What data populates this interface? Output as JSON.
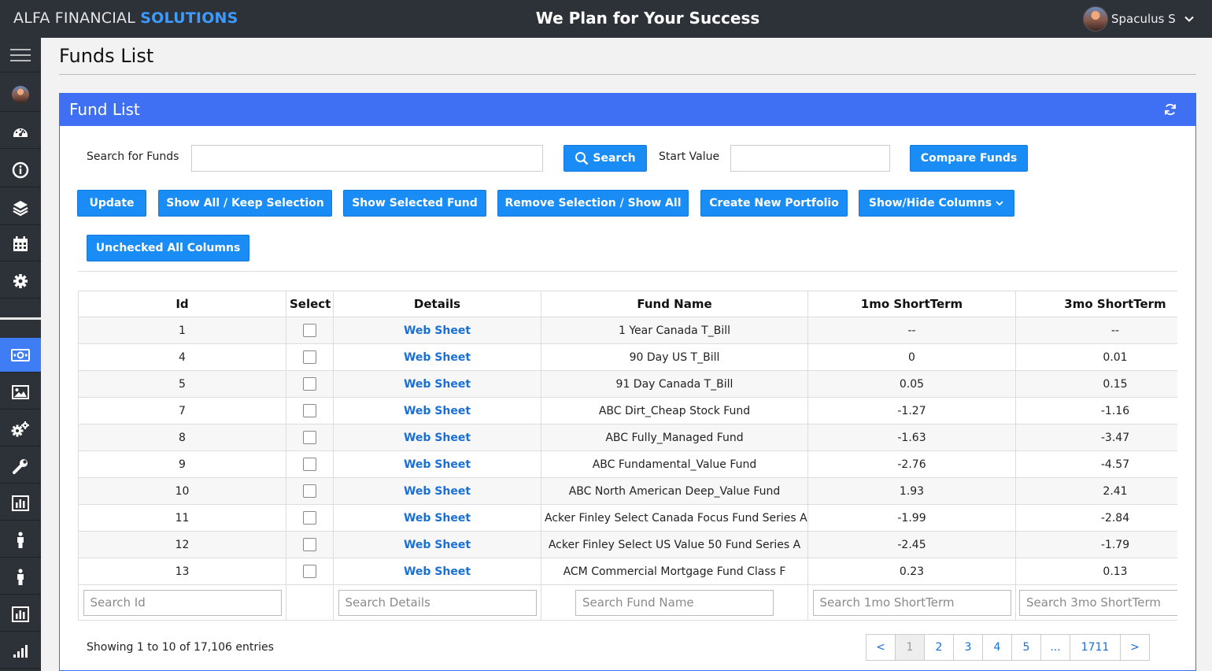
{
  "app": {
    "brand_part1": "ALFA FINANCIAL ",
    "brand_part2": "SOLUTIONS",
    "tagline": "We Plan for Your Success",
    "user_name": "Spaculus S"
  },
  "sidebar": {
    "items": [
      {
        "icon": "hamburger-menu-icon"
      },
      {
        "icon": "user-avatar-icon"
      },
      {
        "icon": "dashboard-icon"
      },
      {
        "icon": "info-icon"
      },
      {
        "icon": "layers-icon"
      },
      {
        "icon": "calendar-icon"
      },
      {
        "icon": "gear-icon"
      },
      {
        "icon": "money-icon",
        "active": true
      },
      {
        "icon": "image-icon"
      },
      {
        "icon": "cogs-icon"
      },
      {
        "icon": "wrench-icon"
      },
      {
        "icon": "bar-chart-icon"
      },
      {
        "icon": "person-icon"
      },
      {
        "icon": "person-icon"
      },
      {
        "icon": "bar-chart-icon"
      },
      {
        "icon": "signal-icon"
      }
    ]
  },
  "page": {
    "title": "Funds List"
  },
  "panel": {
    "title": "Fund List",
    "search_label": "Search for Funds",
    "search_value": "",
    "search_button": "Search",
    "start_value_label": "Start Value",
    "start_value": "",
    "compare_button": "Compare Funds",
    "buttons": {
      "update": "Update",
      "show_all_keep": "Show All / Keep Selection",
      "show_selected": "Show Selected Fund",
      "remove_selection": "Remove Selection / Show All",
      "create_portfolio": "Create New Portfolio",
      "show_hide_columns": "Show/Hide Columns",
      "unchecked_all": "Unchecked All Columns"
    }
  },
  "table": {
    "columns": [
      "Id",
      "Select",
      "Details",
      "Fund Name",
      "1mo ShortTerm",
      "3mo ShortTerm"
    ],
    "rows": [
      {
        "id": "1",
        "details": "Web Sheet",
        "fund_name": "1 Year Canada T_Bill",
        "mo1": "--",
        "mo3": "--"
      },
      {
        "id": "4",
        "details": "Web Sheet",
        "fund_name": "90 Day US T_Bill",
        "mo1": "0",
        "mo3": "0.01"
      },
      {
        "id": "5",
        "details": "Web Sheet",
        "fund_name": "91 Day Canada T_Bill",
        "mo1": "0.05",
        "mo3": "0.15"
      },
      {
        "id": "7",
        "details": "Web Sheet",
        "fund_name": "ABC Dirt_Cheap Stock Fund",
        "mo1": "-1.27",
        "mo3": "-1.16"
      },
      {
        "id": "8",
        "details": "Web Sheet",
        "fund_name": "ABC Fully_Managed Fund",
        "mo1": "-1.63",
        "mo3": "-3.47"
      },
      {
        "id": "9",
        "details": "Web Sheet",
        "fund_name": "ABC Fundamental_Value Fund",
        "mo1": "-2.76",
        "mo3": "-4.57"
      },
      {
        "id": "10",
        "details": "Web Sheet",
        "fund_name": "ABC North American Deep_Value Fund",
        "mo1": "1.93",
        "mo3": "2.41"
      },
      {
        "id": "11",
        "details": "Web Sheet",
        "fund_name": "Acker Finley Select Canada Focus Fund Series A",
        "mo1": "-1.99",
        "mo3": "-2.84"
      },
      {
        "id": "12",
        "details": "Web Sheet",
        "fund_name": "Acker Finley Select US Value 50 Fund Series A",
        "mo1": "-2.45",
        "mo3": "-1.79"
      },
      {
        "id": "13",
        "details": "Web Sheet",
        "fund_name": "ACM Commercial Mortgage Fund Class F",
        "mo1": "0.23",
        "mo3": "0.13"
      }
    ],
    "filters": {
      "id": "Search Id",
      "details": "Search Details",
      "fund_name": "Search Fund Name",
      "mo1": "Search 1mo ShortTerm",
      "mo3": "Search 3mo ShortTerm"
    }
  },
  "footer": {
    "showing": "Showing 1 to 10 of 17,106 entries",
    "pages": [
      "<",
      "1",
      "2",
      "3",
      "4",
      "5",
      "...",
      "1711",
      ">"
    ],
    "current_page": "1"
  },
  "colors": {
    "topbar": "#2d3239",
    "panel_header": "#3f6ff3",
    "button": "#1a8cf5",
    "link": "#1a6fd6",
    "brand_accent": "#3d9bff"
  }
}
